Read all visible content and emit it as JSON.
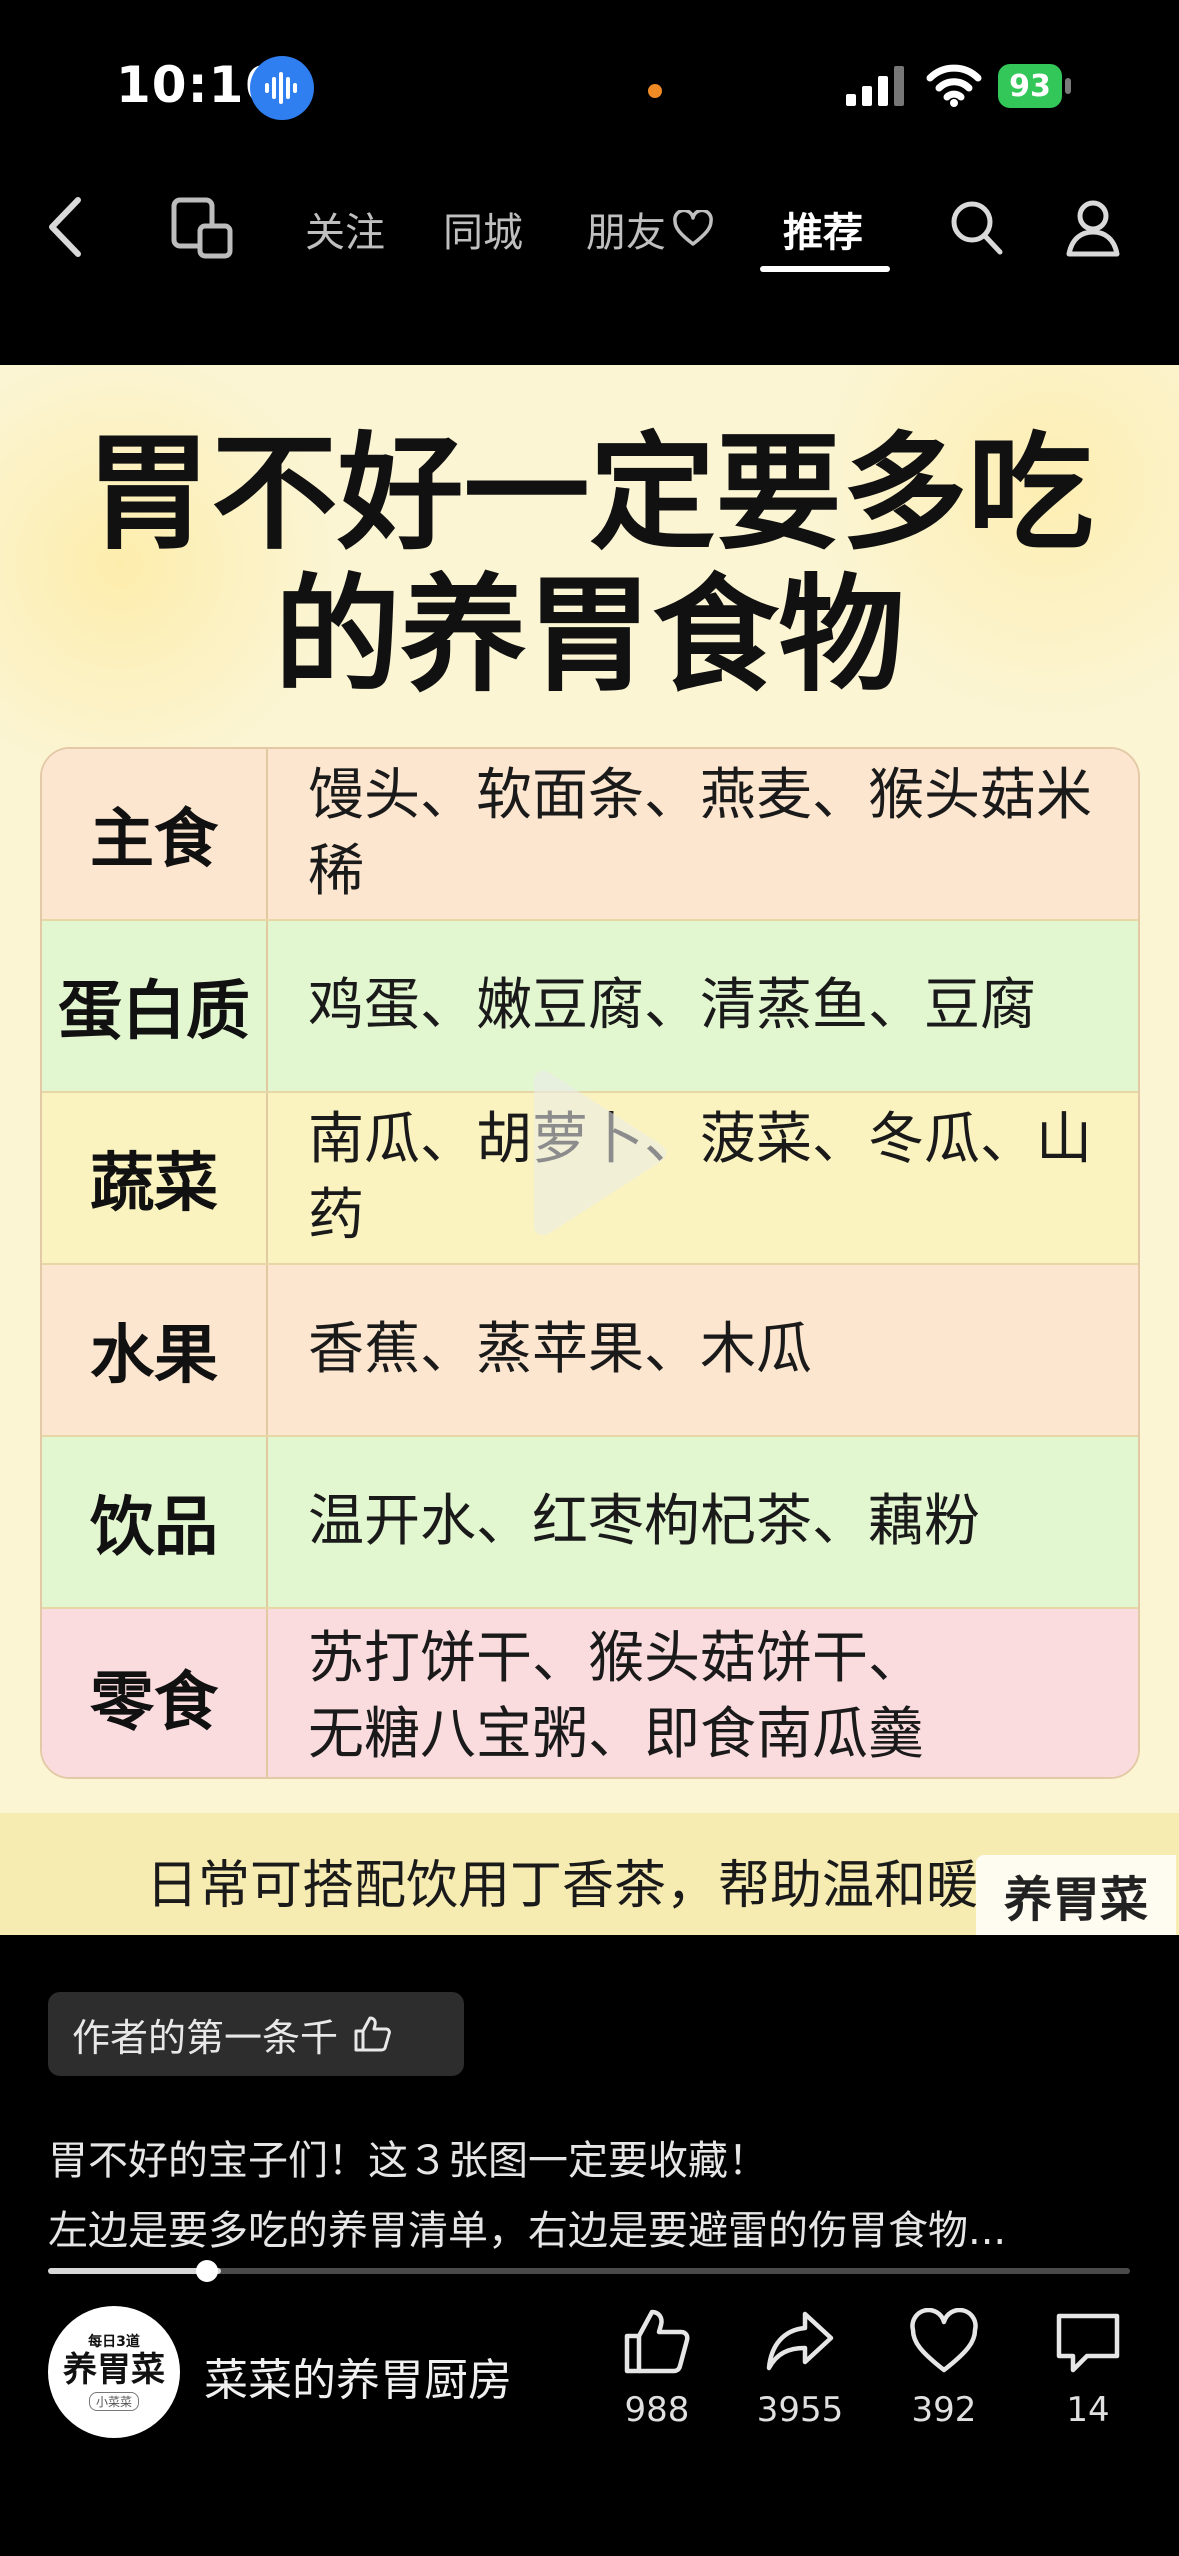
{
  "status_bar": {
    "time": "10:16",
    "battery_level": "93"
  },
  "nav": {
    "tabs": [
      {
        "label": "关注"
      },
      {
        "label": "同城"
      },
      {
        "label": "朋友"
      },
      {
        "label": "推荐",
        "active": true
      }
    ],
    "icons": [
      "back-arrow-icon",
      "device-icon",
      "search-icon",
      "profile-icon"
    ]
  },
  "poster": {
    "title_line1": "胃不好一定要多吃",
    "title_line2": "的养胃食物",
    "rows": [
      {
        "category": "主食",
        "items": "馒头、软面条、燕麦、猴头菇米稀",
        "bg": "#fce6cf"
      },
      {
        "category": "蛋白质",
        "items": "鸡蛋、嫩豆腐、清蒸鱼、豆腐",
        "bg": "#e2f6cf"
      },
      {
        "category": "蔬菜",
        "items": "南瓜、胡萝卜、菠菜、冬瓜、山药",
        "bg": "#fbf3bf"
      },
      {
        "category": "水果",
        "items": "香蕉、蒸苹果、木瓜",
        "bg": "#fce6cf"
      },
      {
        "category": "饮品",
        "items": "温开水、红枣枸杞茶、藕粉",
        "bg": "#e2f6cf"
      },
      {
        "category": "零食",
        "items": "苏打饼干、猴头菇饼干、\n无糖八宝粥、即食南瓜羹",
        "bg": "#fadcdf"
      }
    ],
    "tip": "日常可搭配饮用丁香茶，帮助温和暖",
    "watermark": "养胃菜"
  },
  "author_chip": "作者的第一条千",
  "caption": {
    "line1": "胃不好的宝子们！这３张图一定要收藏！",
    "line2": "左边是要多吃的养胃清单，右边是要避雷的伤胃食物..."
  },
  "progress": 0.16,
  "account": {
    "avatar_small": "每日3道",
    "avatar_big": "养胃菜",
    "avatar_sub": "小菜菜",
    "name": "菜菜的养胃厨房"
  },
  "actions": {
    "like_count": "988",
    "share_count": "3955",
    "favorite_count": "392",
    "comment_count": "14"
  },
  "colors": {
    "accent_blue": "#2f7ff0",
    "battery_green": "#33c759",
    "indicator_orange": "#f08a24"
  }
}
